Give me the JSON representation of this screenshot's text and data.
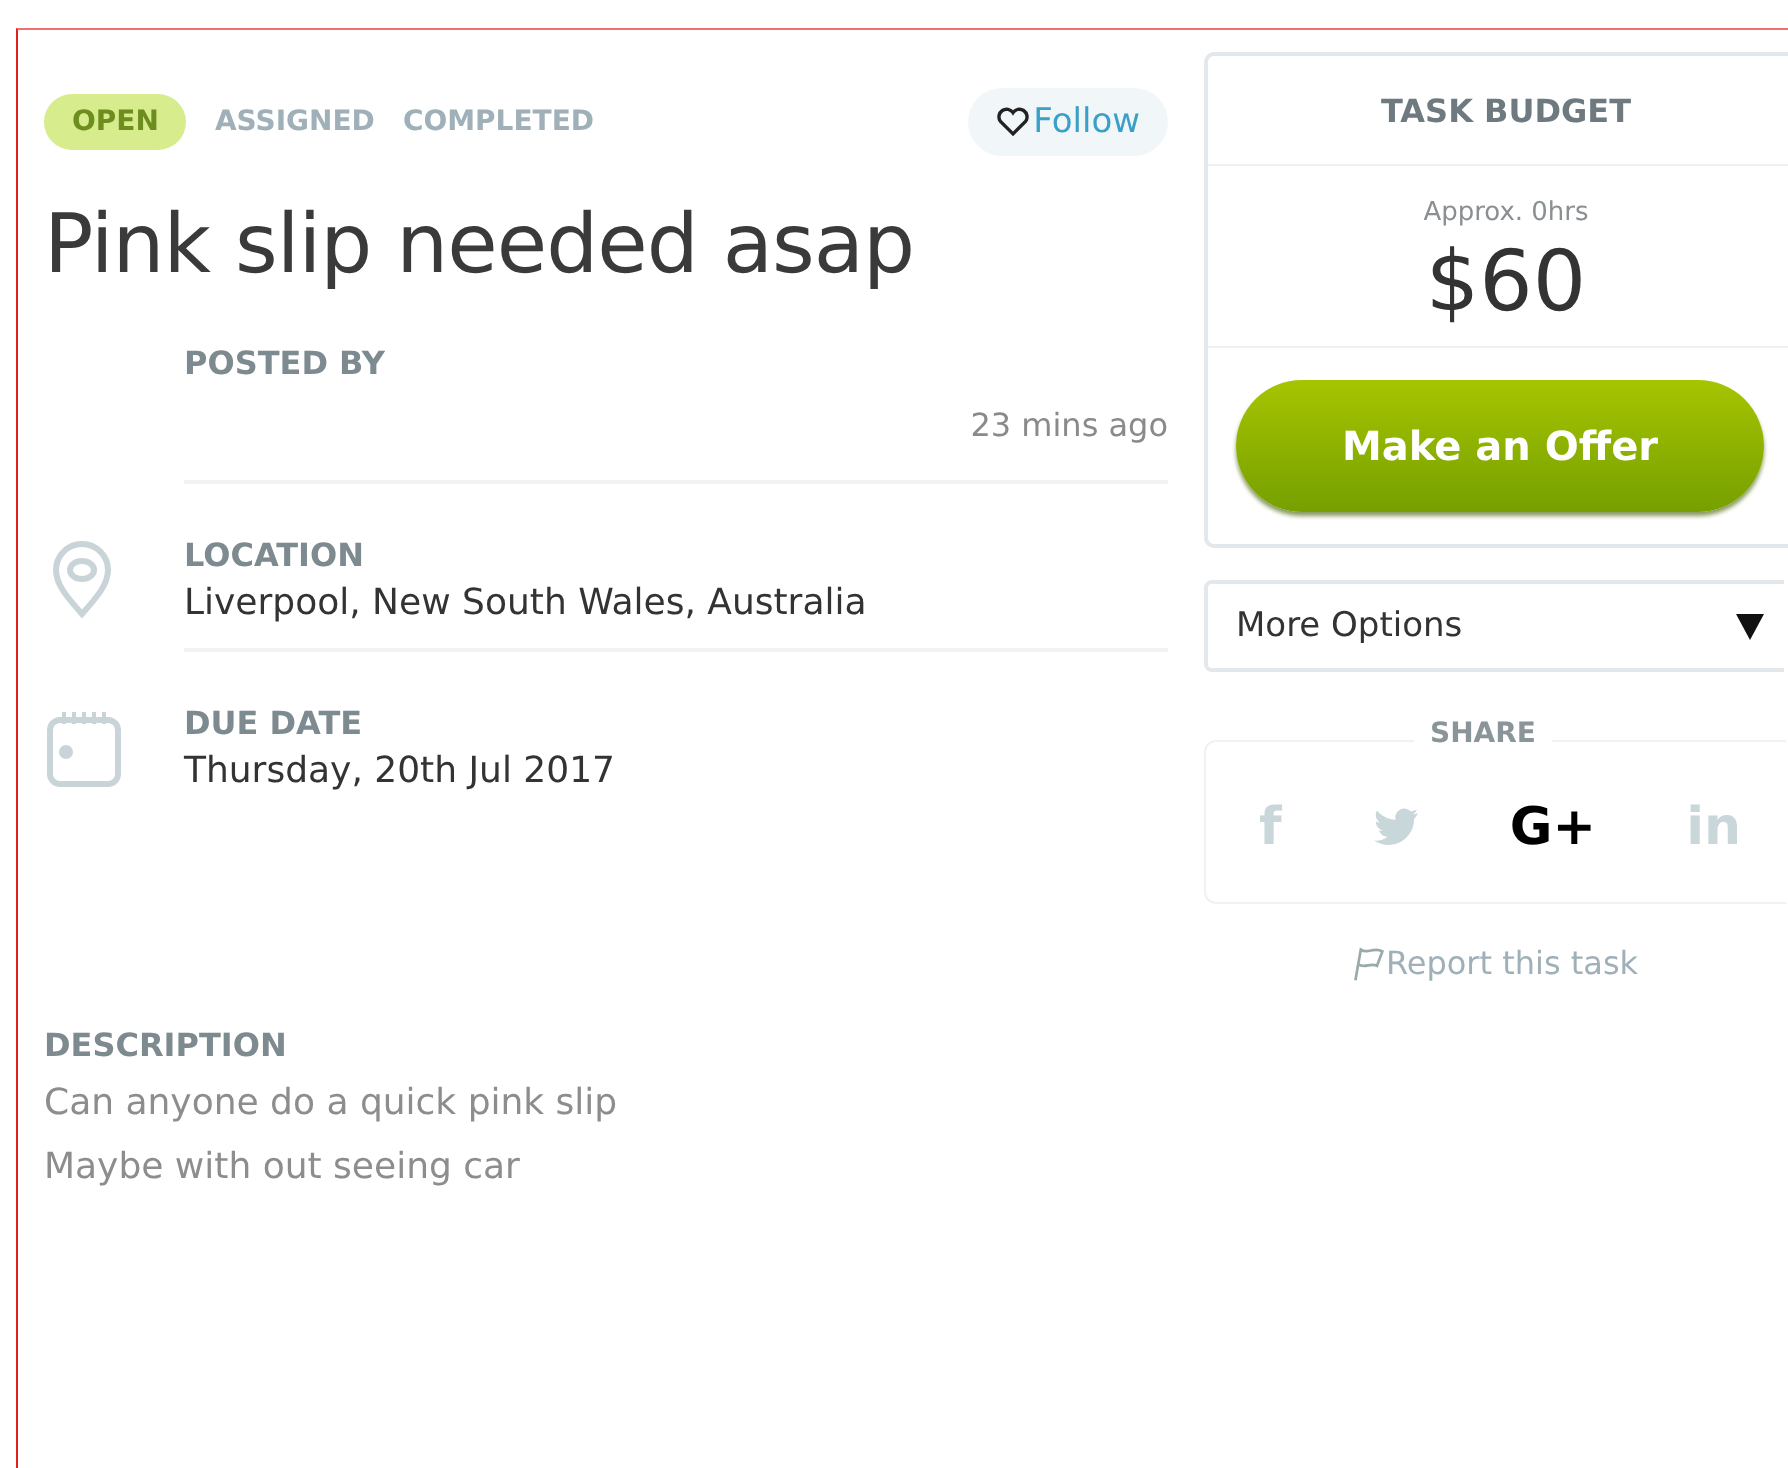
{
  "statuses": [
    {
      "label": "OPEN",
      "selected": true
    },
    {
      "label": "ASSIGNED",
      "selected": false
    },
    {
      "label": "COMPLETED",
      "selected": false
    }
  ],
  "follow": {
    "label": "Follow",
    "following": false
  },
  "title": "Pink slip needed asap",
  "details": [
    {
      "kind": "posted",
      "label": "POSTED BY",
      "time": "23 mins ago"
    },
    {
      "kind": "location",
      "label": "LOCATION",
      "value": "Liverpool, New South Wales, Australia"
    },
    {
      "kind": "date",
      "label": "DUE DATE",
      "value": "Thursday, 20th Jul 2017"
    }
  ],
  "description": {
    "label": "DESCRIPTION",
    "lines": [
      "Can anyone do a quick pink slip",
      "Maybe with out seeing car"
    ]
  },
  "budget": {
    "title": "TASK BUDGET",
    "hours": "Approx. 0hrs",
    "amount": "$60",
    "button": "Make an Offer"
  },
  "more_options": "More Options",
  "share": {
    "label": "SHARE",
    "items": [
      {
        "kind": "facebook",
        "glyph": "f",
        "active": false
      },
      {
        "kind": "twitter",
        "active": false
      },
      {
        "kind": "google",
        "glyph": "G+",
        "active": true
      },
      {
        "kind": "linkedin",
        "glyph": "in",
        "active": false
      }
    ]
  },
  "report": "Report this task"
}
